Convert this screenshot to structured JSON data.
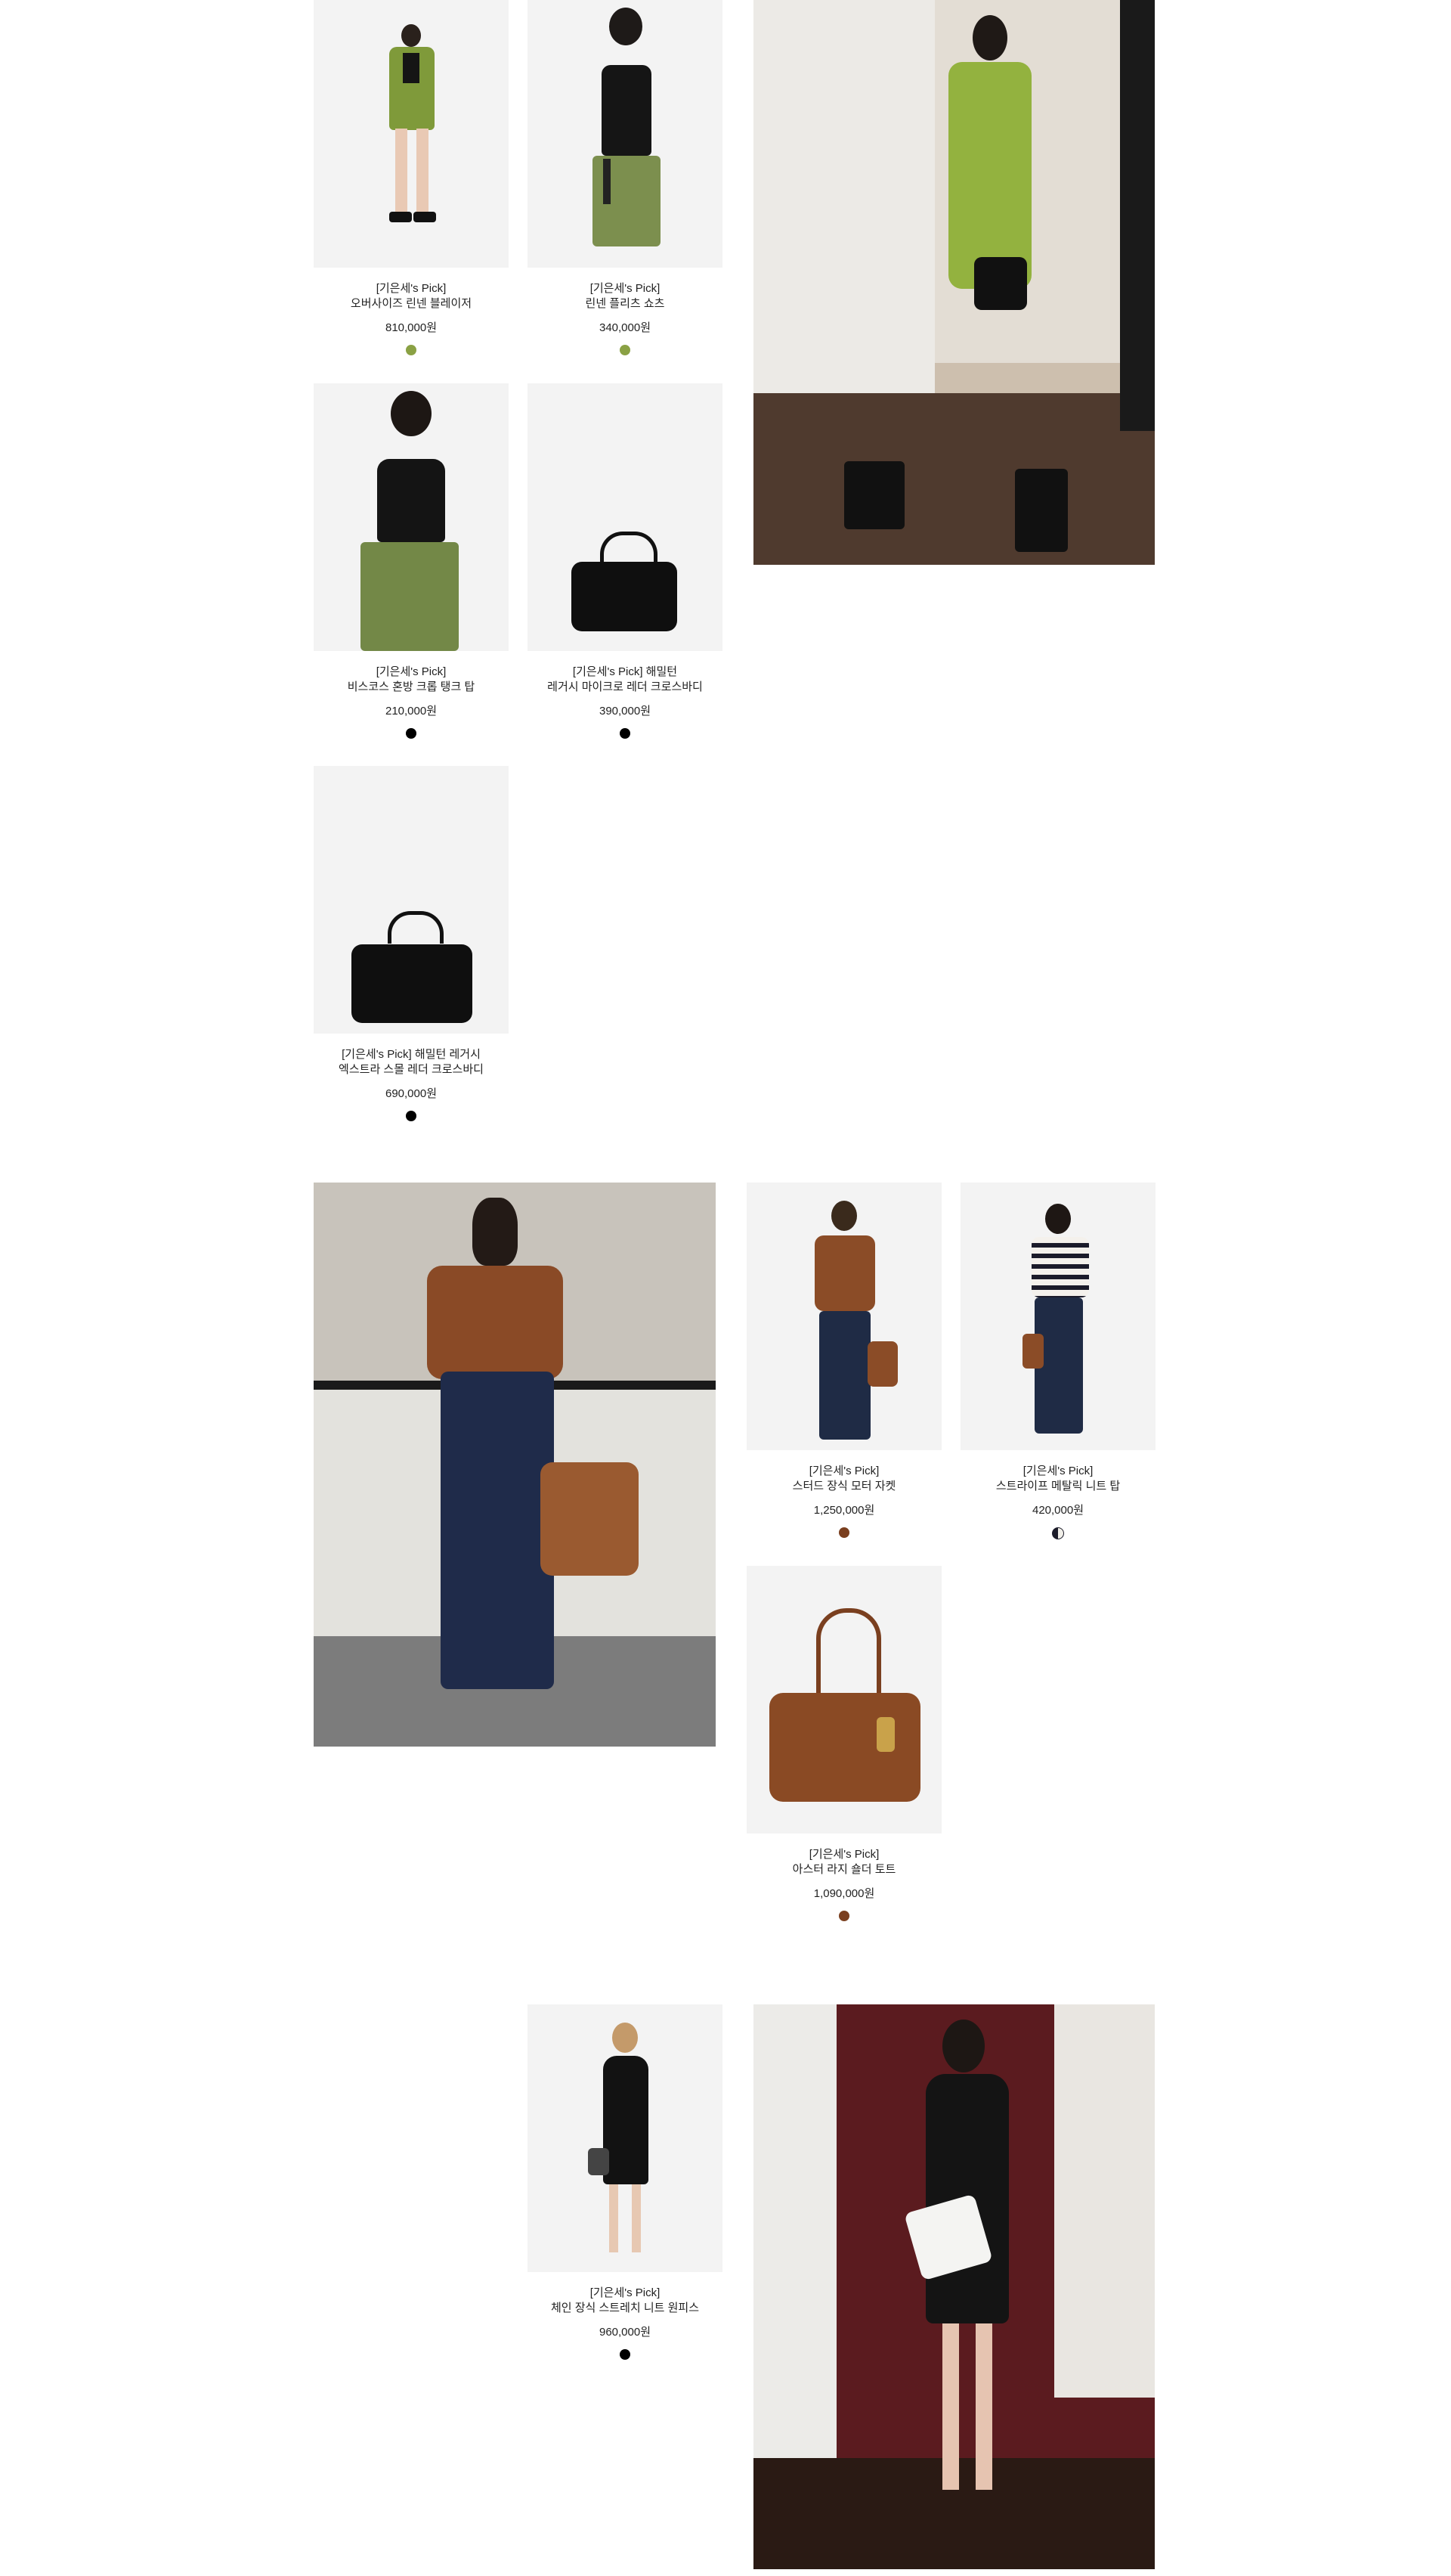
{
  "products": [
    {
      "id": "p1",
      "title": "[기은세's Pick]",
      "name": "오버사이즈 린넨 블레이저",
      "price": "810,000원",
      "swatch": "#8aa144"
    },
    {
      "id": "p2",
      "title": "[기은세's Pick]",
      "name": "린넨 플리츠 쇼츠",
      "price": "340,000원",
      "swatch": "#8aa144"
    },
    {
      "id": "p3",
      "title": "[기은세's Pick]",
      "name": "비스코스 혼방 크롭 탱크 탑",
      "price": "210,000원",
      "swatch": "#000000"
    },
    {
      "id": "p4",
      "title": "[기은세's Pick] 해밀턴",
      "name": "레거시 마이크로 레더 크로스바디",
      "price": "390,000원",
      "swatch": "#000000"
    },
    {
      "id": "p5",
      "title": "[기은세's Pick] 해밀턴 레거시",
      "name": "엑스트라 스몰 레더 크로스바디",
      "price": "690,000원",
      "swatch": "#000000"
    },
    {
      "id": "p6",
      "title": "[기은세's Pick]",
      "name": "스터드 장식 모터 자켓",
      "price": "1,250,000원",
      "swatch": "#7a3f1f"
    },
    {
      "id": "p7",
      "title": "[기은세's Pick]",
      "name": "스트라이프 메탈릭 니트 탑",
      "price": "420,000원",
      "swatch": "#1c1c2a"
    },
    {
      "id": "p8",
      "title": "[기은세's Pick]",
      "name": "아스터 라지 숄더 토트",
      "price": "1,090,000원",
      "swatch": "#7a3f1f"
    },
    {
      "id": "p9",
      "title": "[기은세's Pick]",
      "name": "체인 장식 스트레치 니트 원피스",
      "price": "960,000원",
      "swatch": "#000000"
    }
  ]
}
